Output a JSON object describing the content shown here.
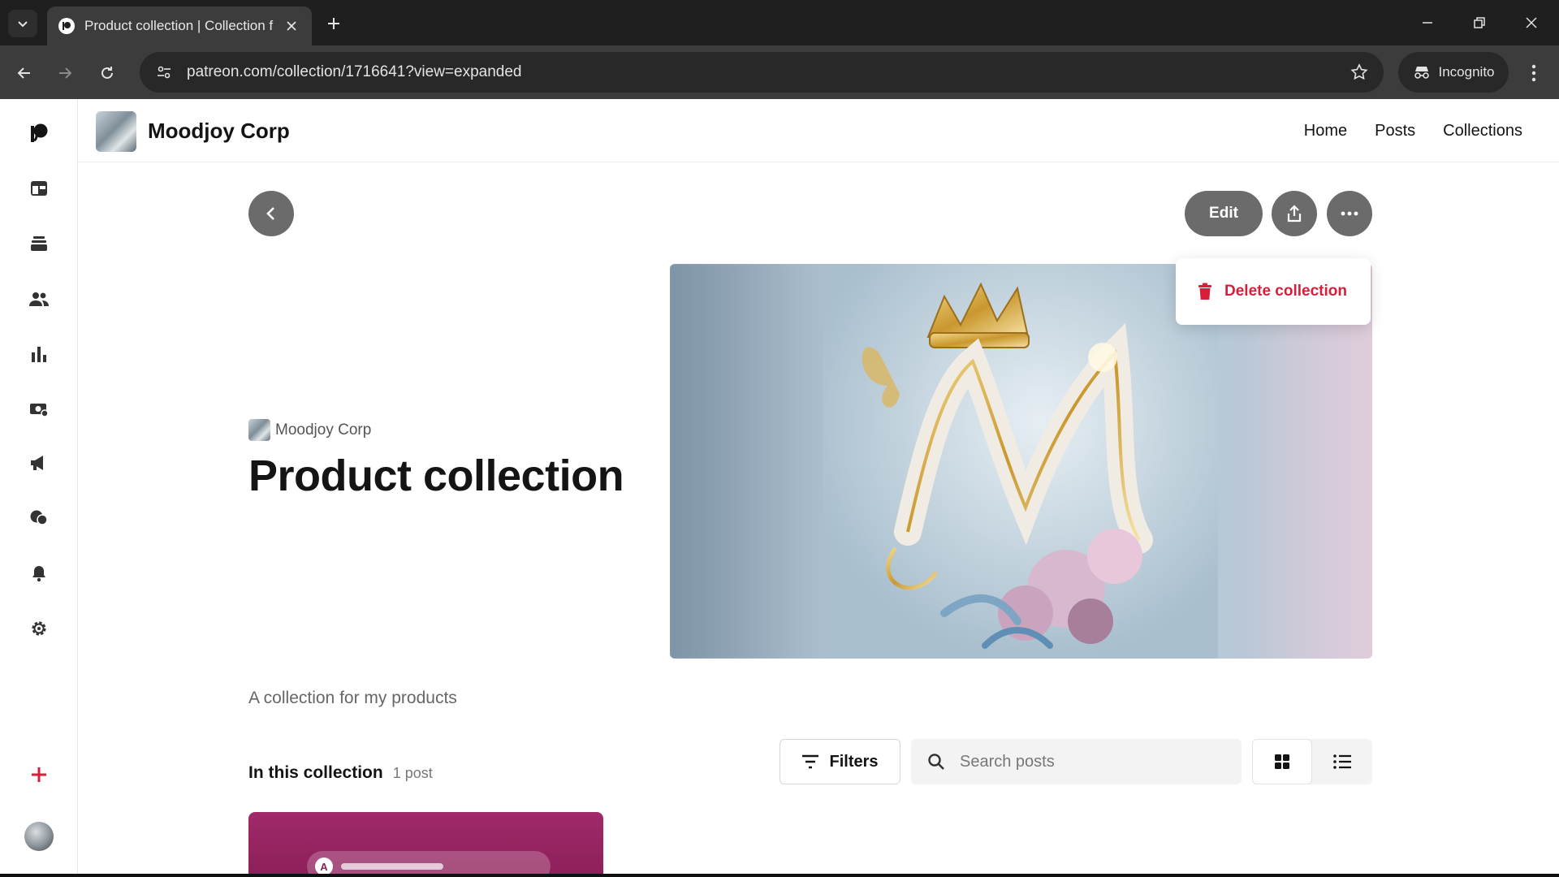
{
  "browser": {
    "tab_title": "Product collection | Collection f",
    "url": "patreon.com/collection/1716641?view=expanded",
    "incognito_label": "Incognito"
  },
  "creator": {
    "name": "Moodjoy Corp"
  },
  "top_nav": {
    "home": "Home",
    "posts": "Posts",
    "collections": "Collections"
  },
  "actions": {
    "edit_label": "Edit"
  },
  "menu": {
    "delete_label": "Delete collection"
  },
  "collection": {
    "creator_name": "Moodjoy Corp",
    "title": "Product collection",
    "description": "A collection for my products",
    "in_collection_label": "In this collection",
    "post_count": "1 post"
  },
  "controls": {
    "filters_label": "Filters",
    "search_placeholder": "Search posts"
  },
  "post_preview": {
    "avatar_letter": "A"
  },
  "colors": {
    "accent_danger": "#d6203b",
    "button_gray": "#6b6b6b",
    "post_card": "#8c1f5a"
  }
}
